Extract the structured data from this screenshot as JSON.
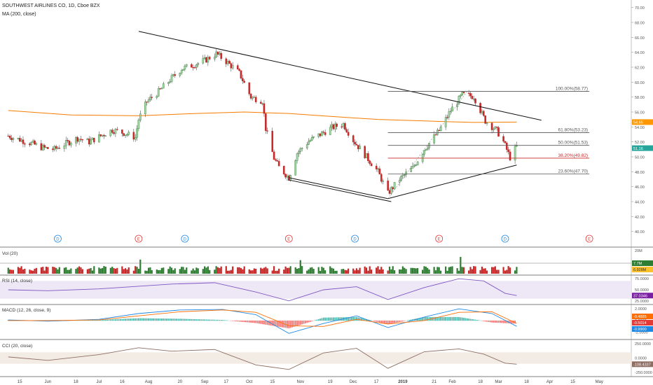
{
  "chart_data": {
    "type": "line",
    "title": "SOUTHWEST AIRLINES CO, 1D, Cboe BZX",
    "ma_label": "MA (200, close)",
    "price_axis": {
      "ylim": [
        38,
        71
      ],
      "ticks": [
        "70.00",
        "68.00",
        "66.00",
        "64.00",
        "62.00",
        "60.00",
        "58.00",
        "56.00",
        "54.00",
        "52.00",
        "50.00",
        "48.00",
        "46.00",
        "44.00",
        "42.00",
        "40.00"
      ],
      "tick_values": [
        70,
        68,
        66,
        64,
        62,
        60,
        58,
        56,
        54,
        52,
        50,
        48,
        46,
        44,
        42,
        40
      ],
      "scale": "linear",
      "grid": false
    },
    "x_axis": {
      "ticks": [
        "15",
        "Jun",
        "18",
        "Jul",
        "16",
        "Aug",
        "20",
        "Sep",
        "17",
        "Oct",
        "15",
        "Nov",
        "19",
        "Dec",
        "17",
        "2019",
        "21",
        "Feb",
        "18",
        "Mar",
        "18",
        "Apr",
        "15",
        "May"
      ],
      "tick_dates": [
        "2018-05-15",
        "2018-06-01",
        "2018-06-18",
        "2018-07-02",
        "2018-07-16",
        "2018-08-01",
        "2018-08-20",
        "2018-09-04",
        "2018-09-17",
        "2018-10-01",
        "2018-10-15",
        "2018-11-01",
        "2018-11-19",
        "2018-12-03",
        "2018-12-17",
        "2019-01-02",
        "2019-01-21",
        "2019-02-01",
        "2019-02-18",
        "2019-03-01",
        "2019-03-18",
        "2019-04-01",
        "2019-04-15",
        "2019-05-01"
      ],
      "bold": [
        "2019"
      ]
    },
    "price_series": {
      "name": "",
      "x": [
        "2018-05-08",
        "2018-05-15",
        "2018-05-22",
        "2018-05-29",
        "2018-06-05",
        "2018-06-12",
        "2018-06-19",
        "2018-06-26",
        "2018-07-03",
        "2018-07-10",
        "2018-07-17",
        "2018-07-24",
        "2018-07-26",
        "2018-07-31",
        "2018-08-07",
        "2018-08-14",
        "2018-08-21",
        "2018-08-28",
        "2018-09-04",
        "2018-09-11",
        "2018-09-18",
        "2018-09-25",
        "2018-10-02",
        "2018-10-09",
        "2018-10-11",
        "2018-10-16",
        "2018-10-19",
        "2018-10-25",
        "2018-10-30",
        "2018-11-06",
        "2018-11-13",
        "2018-11-20",
        "2018-11-27",
        "2018-12-03",
        "2018-12-11",
        "2018-12-18",
        "2018-12-24",
        "2018-12-31",
        "2019-01-08",
        "2019-01-15",
        "2019-01-24",
        "2019-01-31",
        "2019-02-07",
        "2019-02-14",
        "2019-02-21",
        "2019-02-28",
        "2019-03-04",
        "2019-03-08",
        "2019-03-12"
      ],
      "close": [
        52.8,
        52.3,
        51.8,
        51.2,
        51.0,
        51.8,
        52.5,
        52.0,
        52.8,
        53.6,
        53.2,
        52.6,
        55.0,
        57.4,
        58.7,
        60.3,
        61.8,
        62.3,
        62.9,
        63.8,
        62.6,
        61.2,
        58.0,
        57.5,
        53.8,
        49.8,
        48.6,
        47.2,
        50.5,
        52.1,
        53.0,
        53.9,
        54.4,
        52.2,
        50.0,
        48.0,
        45.1,
        47.0,
        48.5,
        51.0,
        53.5,
        56.2,
        58.3,
        58.1,
        54.8,
        53.5,
        52.0,
        49.9,
        51.4
      ]
    },
    "ma200": {
      "name": "",
      "x": [
        "2018-05-08",
        "2018-06-15",
        "2018-07-26",
        "2018-08-30",
        "2018-09-28",
        "2018-10-25",
        "2018-11-20",
        "2018-12-18",
        "2019-01-15",
        "2019-02-14",
        "2019-03-12"
      ],
      "values": [
        56.2,
        55.6,
        55.5,
        55.8,
        56.0,
        55.8,
        55.4,
        55.0,
        54.8,
        54.6,
        54.65
      ]
    },
    "trendlines": [
      {
        "name": "",
        "from": [
          "2018-07-26",
          66.8
        ],
        "to": [
          "2019-03-27",
          54.9
        ]
      },
      {
        "name": "",
        "from": [
          "2018-10-25",
          47.2
        ],
        "to": [
          "2018-12-24",
          44.4
        ]
      },
      {
        "name": "",
        "from": [
          "2018-10-25",
          46.9
        ],
        "to": [
          "2018-12-26",
          44.0
        ]
      },
      {
        "name": "",
        "from": [
          "2018-12-24",
          44.4
        ],
        "to": [
          "2019-03-12",
          48.9
        ]
      }
    ],
    "fibonacci": [
      {
        "label": "100.00%(58.77)",
        "value": 58.77,
        "color": "#555555"
      },
      {
        "label": "61.80%(53.23)",
        "value": 53.23,
        "color": "#555555"
      },
      {
        "label": "50.00%(51.53)",
        "value": 51.53,
        "color": "#555555"
      },
      {
        "label": "38.20%(49.82)",
        "value": 49.82,
        "color": "#c62828"
      },
      {
        "label": "23.60%(47.70)",
        "value": 47.7,
        "color": "#555555"
      }
    ],
    "price_badges": [
      {
        "label": "54.65",
        "value": 54.65,
        "color": "#ff9800"
      },
      {
        "label": "51.16",
        "value": 51.16,
        "color": "#26a69a"
      }
    ],
    "event_markers": [
      {
        "label": "D",
        "date": "2018-06-07",
        "color": "#1e88e5"
      },
      {
        "label": "E",
        "date": "2018-07-26",
        "color": "#e53935"
      },
      {
        "label": "D",
        "date": "2018-08-23",
        "color": "#1e88e5"
      },
      {
        "label": "E",
        "date": "2018-10-25",
        "color": "#e53935"
      },
      {
        "label": "D",
        "date": "2018-12-04",
        "color": "#1e88e5"
      },
      {
        "label": "E",
        "date": "2019-01-24",
        "color": "#e53935"
      },
      {
        "label": "D",
        "date": "2019-03-05",
        "color": "#1e88e5"
      },
      {
        "label": "E",
        "date": "2019-04-25",
        "color": "#e53935"
      }
    ],
    "volume": {
      "label": "Vol (20)",
      "axis_label": "20M",
      "badges": [
        {
          "label": "7.7M",
          "color": "#2e7d32"
        },
        {
          "label": "6.928M",
          "color": "#fbc02d"
        }
      ]
    },
    "rsi": {
      "label": "RSI (14, close)",
      "ticks": [
        "75.0000",
        "50.0000",
        "25.0000"
      ],
      "badge": {
        "label": "37.0346",
        "color": "#7b1fa2"
      },
      "ylim": [
        20,
        80
      ],
      "band": [
        30,
        70
      ],
      "x": [
        "2018-05-08",
        "2018-06-01",
        "2018-07-02",
        "2018-07-26",
        "2018-08-15",
        "2018-09-10",
        "2018-10-05",
        "2018-10-25",
        "2018-11-15",
        "2018-12-05",
        "2018-12-24",
        "2019-01-15",
        "2019-02-05",
        "2019-02-20",
        "2019-03-05",
        "2019-03-12"
      ],
      "values": [
        50,
        48,
        52,
        58,
        63,
        66,
        45,
        25,
        50,
        57,
        28,
        55,
        75,
        70,
        42,
        37
      ]
    },
    "macd": {
      "label": "MACD (12, 26, close, 9)",
      "ticks": [
        "2.0000",
        "0.0000",
        "-2.0000"
      ],
      "badges": [
        {
          "label": "-0.4885",
          "color": "#ff6d00"
        },
        {
          "label": "-0.5014",
          "color": "#e53935"
        },
        {
          "label": "-0.9900",
          "color": "#1e88e5"
        }
      ],
      "ylim": [
        -3,
        2.5
      ],
      "x": [
        "2018-05-08",
        "2018-06-01",
        "2018-07-02",
        "2018-07-26",
        "2018-08-20",
        "2018-09-15",
        "2018-10-05",
        "2018-10-25",
        "2018-11-15",
        "2018-12-05",
        "2018-12-24",
        "2019-01-15",
        "2019-02-05",
        "2019-02-25",
        "2019-03-12"
      ],
      "macd": [
        0.1,
        -0.1,
        0.2,
        1.2,
        1.8,
        1.9,
        1.0,
        -2.2,
        -0.5,
        0.8,
        -1.2,
        0.6,
        2.0,
        1.2,
        -0.99
      ],
      "signal": [
        0.0,
        0.0,
        0.1,
        0.8,
        1.5,
        1.8,
        1.4,
        -0.9,
        -1.0,
        0.2,
        -0.6,
        0.0,
        1.4,
        1.5,
        -0.49
      ],
      "histogram": [
        0.1,
        -0.1,
        0.1,
        0.4,
        0.3,
        0.1,
        -0.4,
        -1.3,
        0.5,
        0.6,
        -0.6,
        0.6,
        0.6,
        -0.3,
        -0.5
      ]
    },
    "cci": {
      "label": "CCI (20, close)",
      "ticks": [
        "250.0000",
        "0.0000",
        "-250.0000"
      ],
      "badge": {
        "label": "-108.4337",
        "color": "#8d6e63"
      },
      "ylim": [
        -300,
        300
      ],
      "band": [
        -100,
        100
      ],
      "x": [
        "2018-05-08",
        "2018-06-01",
        "2018-07-02",
        "2018-07-26",
        "2018-08-15",
        "2018-09-10",
        "2018-10-05",
        "2018-10-25",
        "2018-11-15",
        "2018-12-05",
        "2018-12-24",
        "2019-01-15",
        "2019-02-05",
        "2019-02-20",
        "2019-03-05",
        "2019-03-12"
      ],
      "values": [
        20,
        -40,
        60,
        180,
        120,
        150,
        -120,
        -200,
        90,
        170,
        -180,
        110,
        160,
        70,
        -90,
        -108
      ]
    }
  }
}
